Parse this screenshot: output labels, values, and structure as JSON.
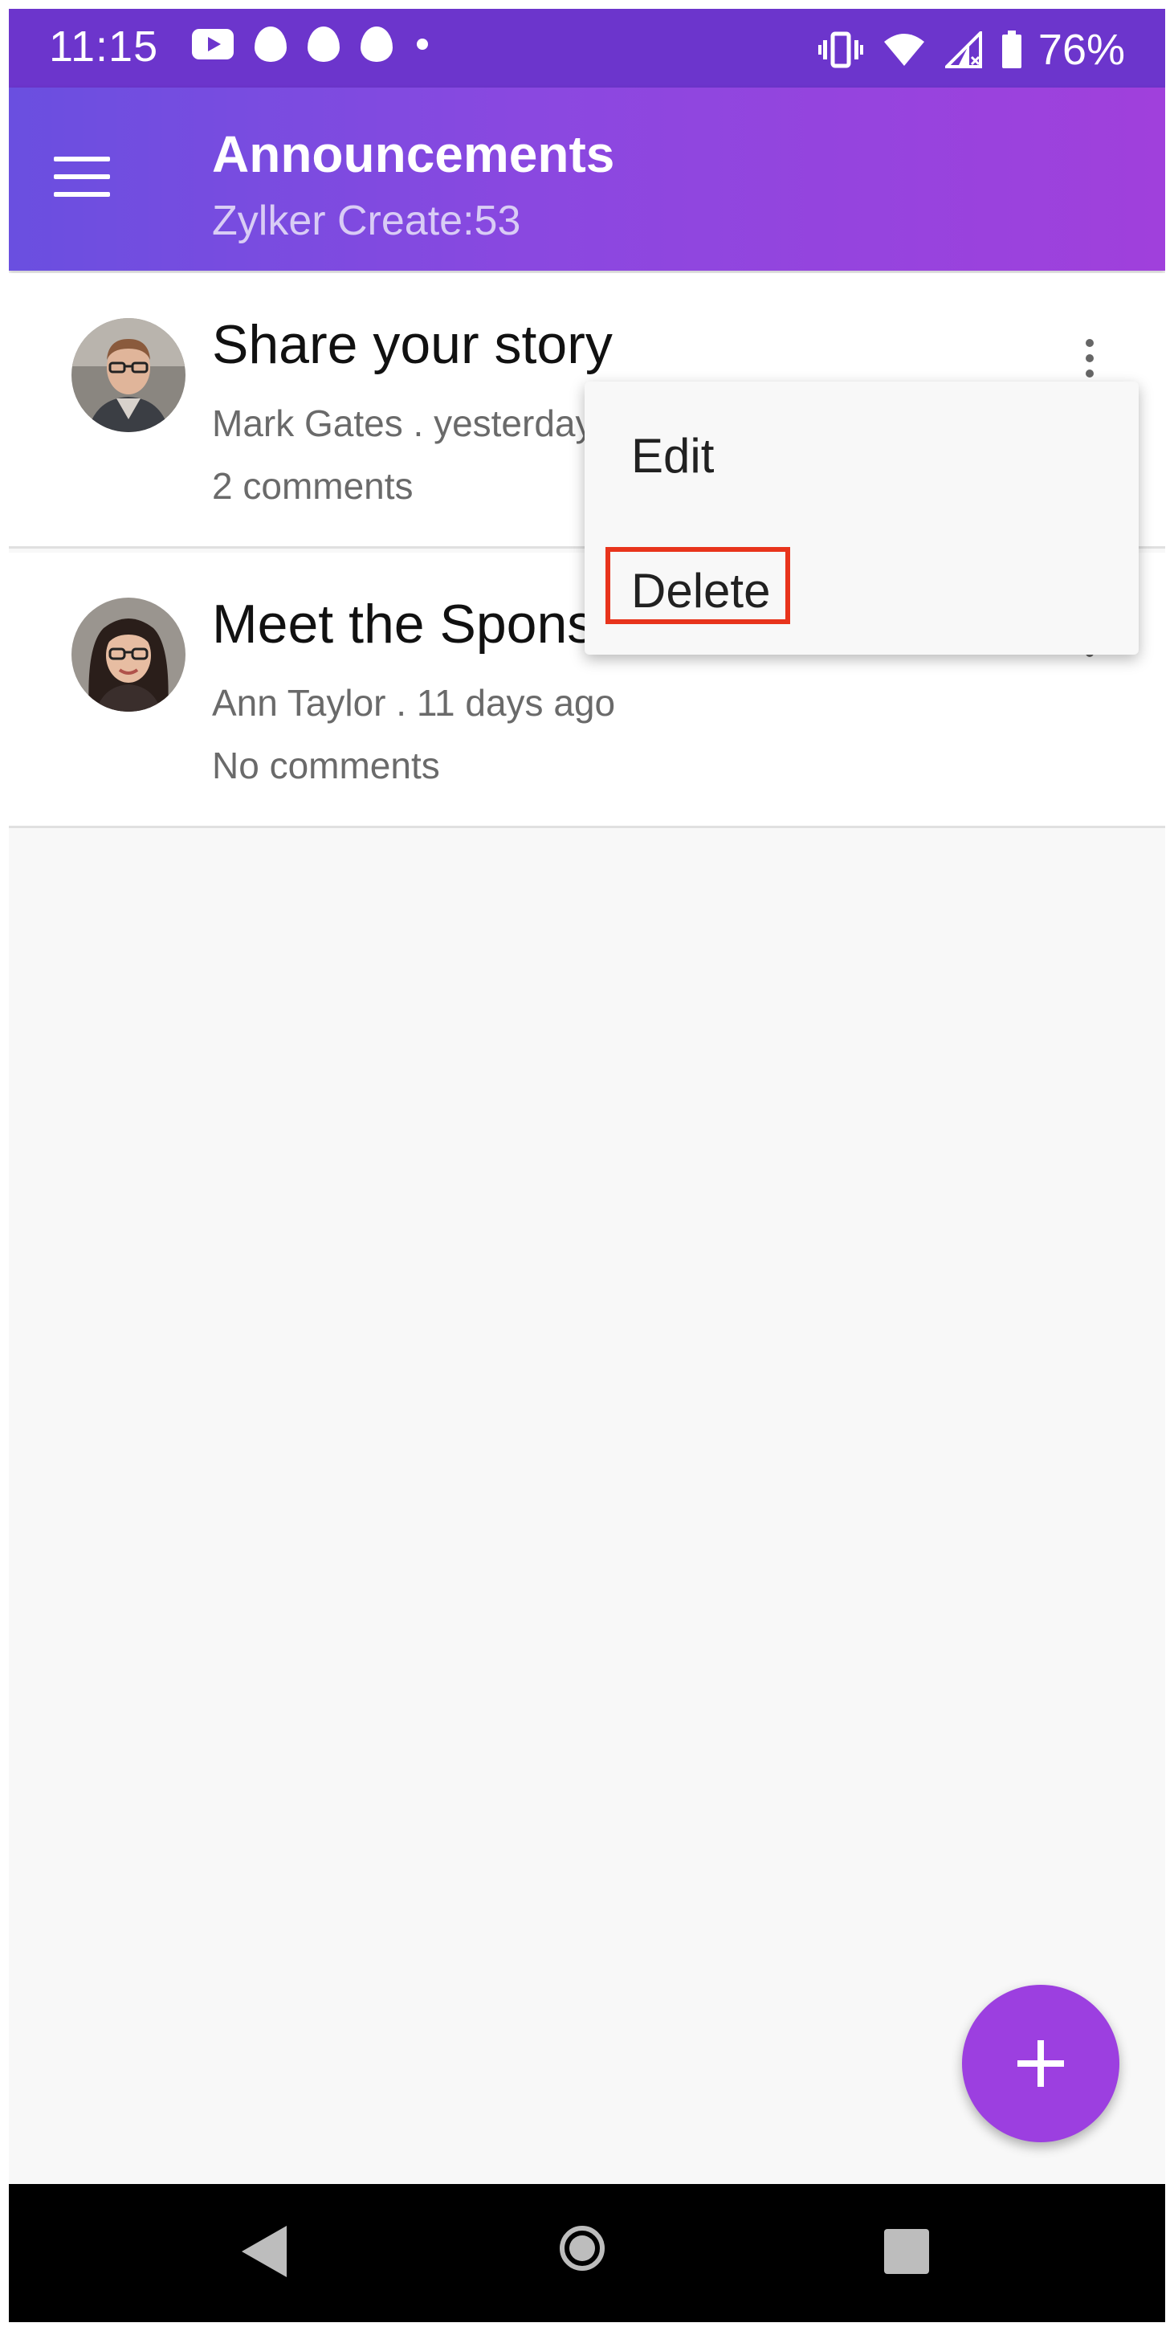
{
  "status_bar": {
    "time": "11:15",
    "battery": "76%"
  },
  "app_bar": {
    "title": "Announcements",
    "subtitle": "Zylker Create:53"
  },
  "announcements": [
    {
      "title": "Share your story",
      "meta": "Mark Gates . yesterday",
      "comments": "2 comments"
    },
    {
      "title": "Meet the Sponsors",
      "meta": "Ann Taylor . 11 days ago",
      "comments": "No comments"
    }
  ],
  "context_menu": {
    "items": [
      "Edit",
      "Delete"
    ],
    "highlighted": "Delete"
  },
  "colors": {
    "app_bar_start": "#6a4fe0",
    "app_bar_end": "#a040dc",
    "fab": "#9c3fe0",
    "highlight_box": "#e8341c"
  }
}
